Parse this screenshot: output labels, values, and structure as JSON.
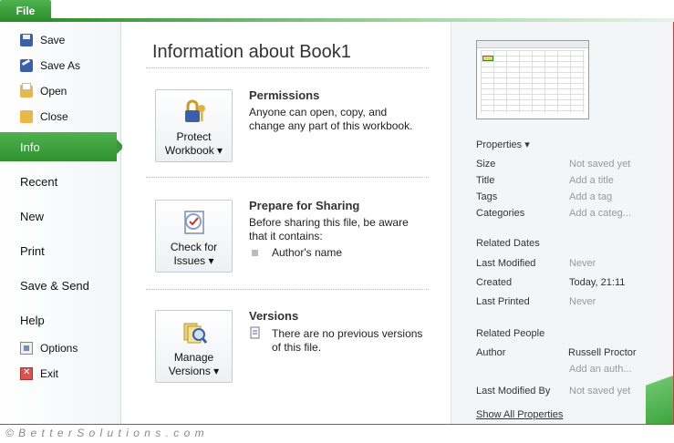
{
  "file_tab": "File",
  "nav": {
    "commands": [
      {
        "label": "Save",
        "icon": "save-icon"
      },
      {
        "label": "Save As",
        "icon": "save-as-icon"
      },
      {
        "label": "Open",
        "icon": "open-folder-icon"
      },
      {
        "label": "Close",
        "icon": "close-folder-icon"
      }
    ],
    "items": [
      "Info",
      "Recent",
      "New",
      "Print",
      "Save & Send",
      "Help"
    ],
    "bottom_commands": [
      {
        "label": "Options",
        "icon": "options-icon"
      },
      {
        "label": "Exit",
        "icon": "exit-icon"
      }
    ]
  },
  "main": {
    "title": "Information about Book1",
    "sections": [
      {
        "button_line1": "Protect",
        "button_line2": "Workbook ▾",
        "heading": "Permissions",
        "text": "Anyone can open, copy, and change any part of this workbook."
      },
      {
        "button_line1": "Check for",
        "button_line2": "Issues ▾",
        "heading": "Prepare for Sharing",
        "text": "Before sharing this file, be aware that it contains:",
        "bullet": "Author's name"
      },
      {
        "button_line1": "Manage",
        "button_line2": "Versions ▾",
        "heading": "Versions",
        "text": "There are no previous versions of this file."
      }
    ]
  },
  "side": {
    "properties_header": "Properties ▾",
    "properties": [
      {
        "key": "Size",
        "value": "Not saved yet"
      },
      {
        "key": "Title",
        "value": "Add a title"
      },
      {
        "key": "Tags",
        "value": "Add a tag"
      },
      {
        "key": "Categories",
        "value": "Add a categ..."
      }
    ],
    "related_dates_header": "Related Dates",
    "dates": [
      {
        "key": "Last Modified",
        "value": "Never"
      },
      {
        "key": "Created",
        "value": "Today, 21:11"
      },
      {
        "key": "Last Printed",
        "value": "Never"
      }
    ],
    "related_people_header": "Related People",
    "author_key": "Author",
    "author_value": "Russell Proctor",
    "add_author": "Add an auth...",
    "last_modified_by_key": "Last Modified By",
    "last_modified_by_value": "Not saved yet",
    "show_all": "Show All Properties"
  },
  "watermark": "© B e t t e r S o l u t i o n s . c o m",
  "colors": {
    "accent": "#2f922f",
    "frame": "#bb4444"
  }
}
